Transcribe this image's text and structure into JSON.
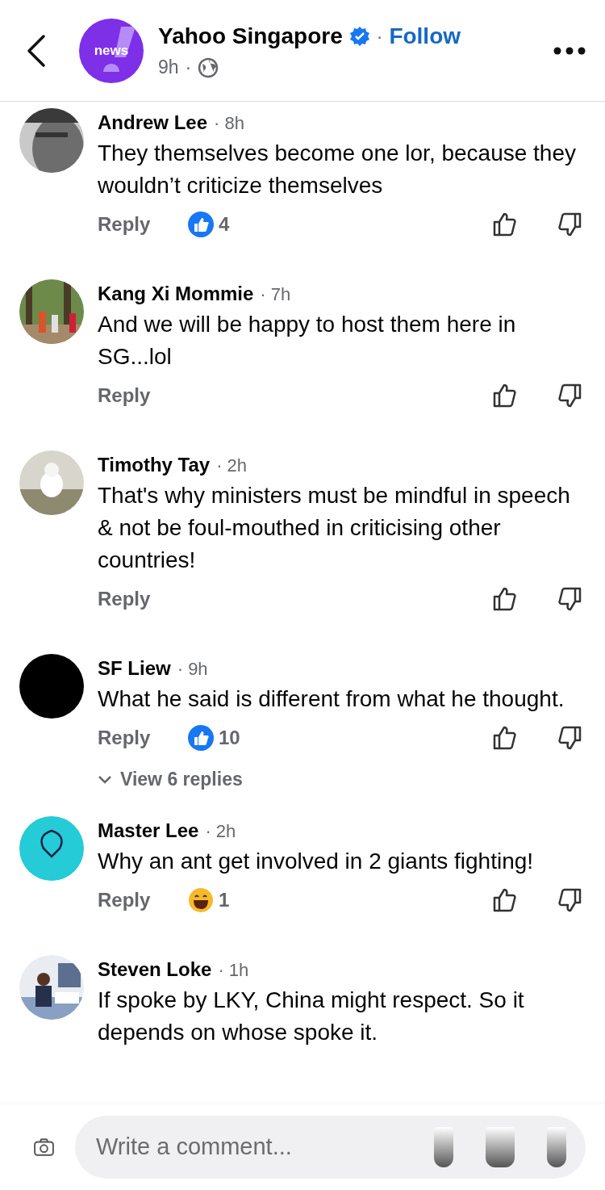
{
  "header": {
    "page_name": "Yahoo Singapore",
    "verified": true,
    "follow": "Follow",
    "separator": "·",
    "time": "9h",
    "logo_text": "news"
  },
  "comments": [
    {
      "author": "Andrew Lee",
      "time": "· 8h",
      "text": "They themselves become one lor, because they wouldn’t criticize themselves",
      "reply": "Reply",
      "reaction": {
        "kind": "like",
        "count": "4"
      }
    },
    {
      "author": "Kang Xi Mommie",
      "time": "· 7h",
      "text": "And we will be happy to host them here in SG...lol",
      "reply": "Reply"
    },
    {
      "author": "Timothy Tay",
      "time": "· 2h",
      "text": "That's why ministers must be mindful in speech & not be foul-mouthed in criticising other countries!",
      "reply": "Reply"
    },
    {
      "author": "SF Liew",
      "time": "· 9h",
      "text": "What he said is different from what he thought.",
      "reply": "Reply",
      "reaction": {
        "kind": "like",
        "count": "10"
      },
      "view_replies": "View 6 replies"
    },
    {
      "author": "Master Lee",
      "time": "· 2h",
      "text": "Why an ant get involved in 2 giants fighting!",
      "reply": "Reply",
      "reaction": {
        "kind": "haha",
        "count": "1"
      }
    },
    {
      "author": "Steven Loke",
      "time": "· 1h",
      "text": "If spoke by LKY, China might respect. So it depends on whose spoke it."
    }
  ],
  "composer": {
    "placeholder": "Write a comment..."
  }
}
